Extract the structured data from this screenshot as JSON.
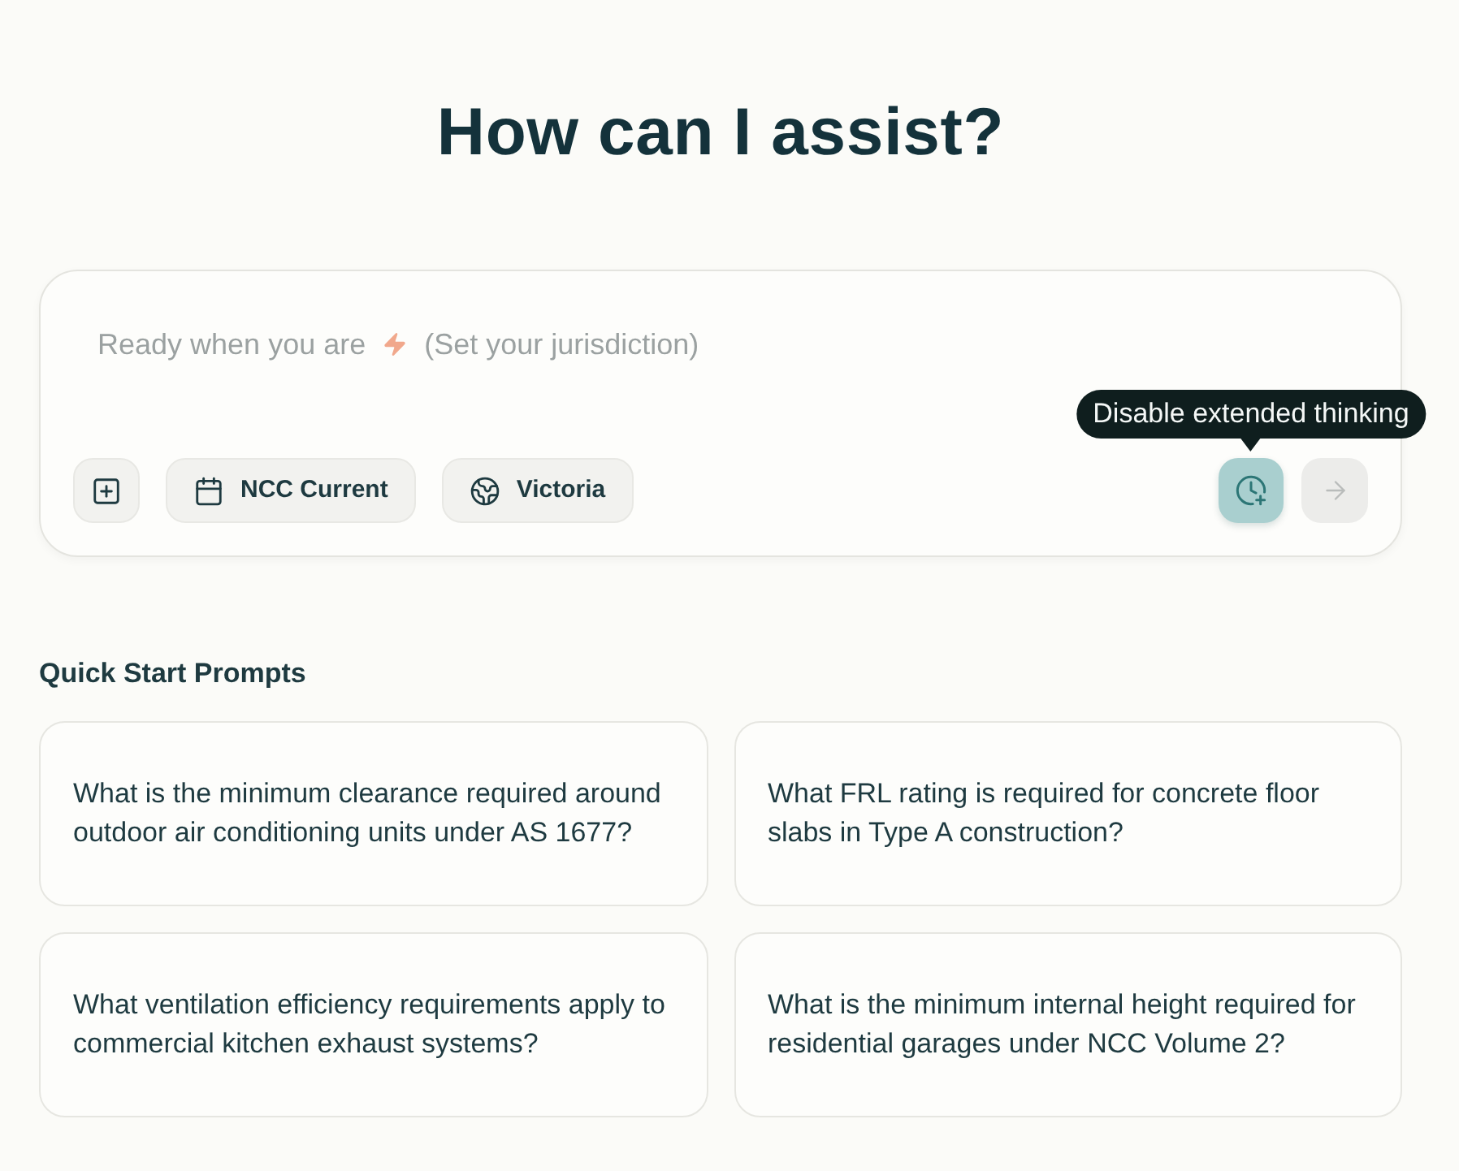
{
  "heading": "How can I assist?",
  "composer": {
    "placeholder": "Ready when you are",
    "hint": "(Set your jurisdiction)",
    "chips": [
      {
        "kind": "standard",
        "label": "NCC Current"
      },
      {
        "kind": "location",
        "label": "Victoria"
      }
    ],
    "thinking": {
      "selected": true,
      "tooltip": "Disable extended thinking"
    },
    "send": {
      "disabled": true
    }
  },
  "prompts": {
    "title": "Quick Start Prompts",
    "items": [
      "What is the minimum clearance required around outdoor air conditioning units under AS 1677?",
      "What FRL rating is required for concrete floor slabs in Type A construction?",
      "What ventilation efficiency requirements apply to commercial kitchen exhaust systems?",
      "What is the minimum internal height required for residential garages under NCC Volume 2?"
    ]
  }
}
